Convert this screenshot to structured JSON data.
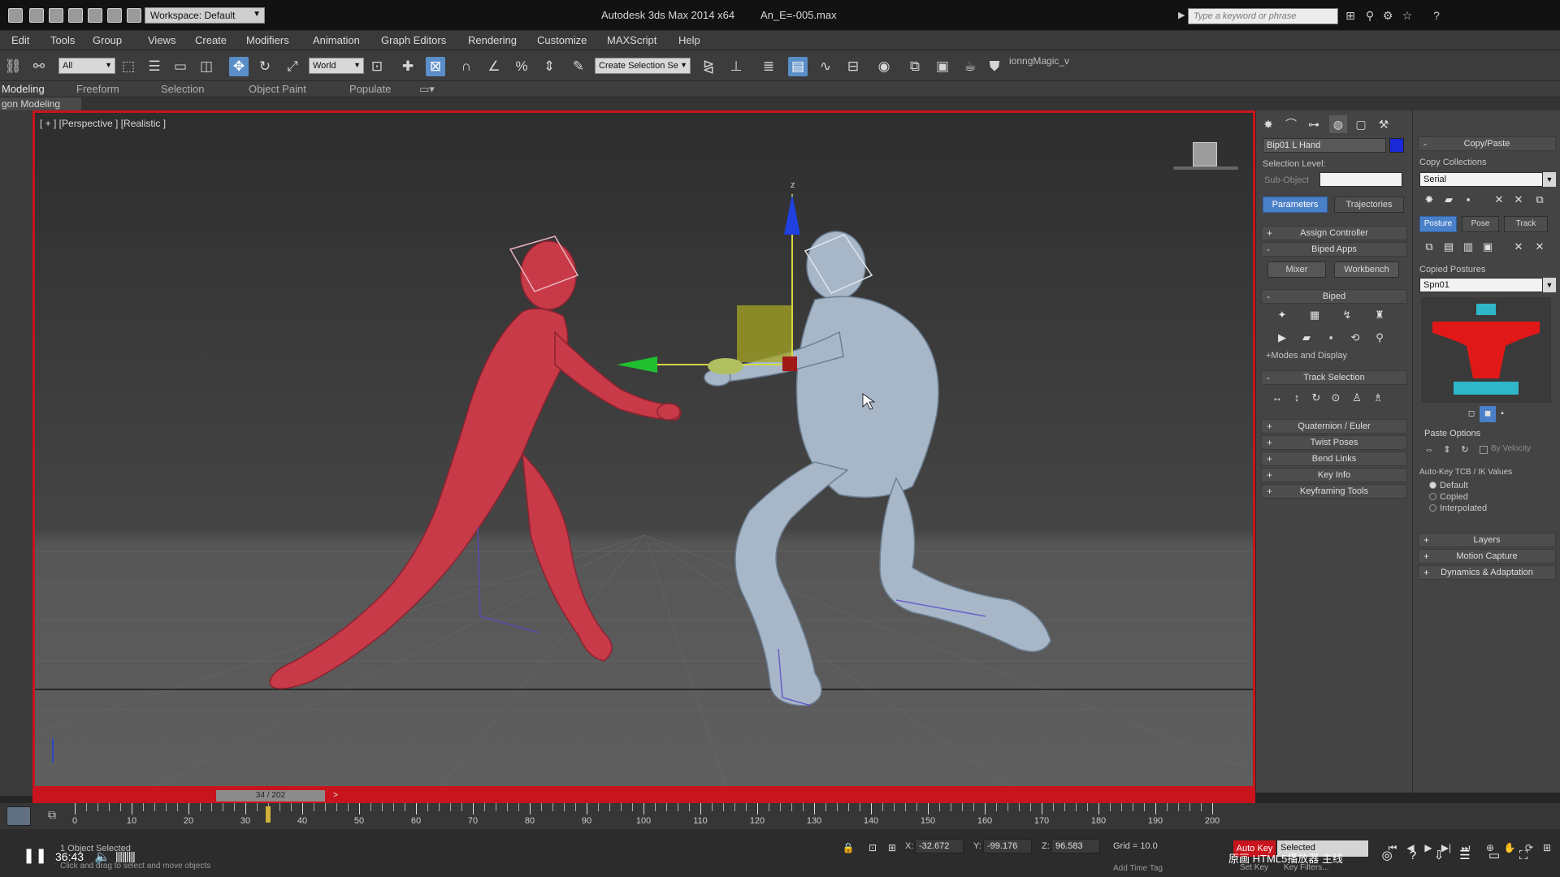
{
  "titlebar": {
    "workspace": "Workspace: Default",
    "app_title": "Autodesk 3ds Max  2014 x64",
    "file_title": "An_E=-005.max",
    "search_placeholder": "Type a keyword or phrase"
  },
  "menu": [
    "Edit",
    "Tools",
    "Group",
    "Views",
    "Create",
    "Modifiers",
    "Animation",
    "Graph Editors",
    "Rendering",
    "Customize",
    "MAXScript",
    "Help"
  ],
  "toolbar": {
    "filter_value": "All",
    "coord_system": "World",
    "named_selection_placeholder": "Create Selection Se",
    "macro_label": "ionngMagic_v"
  },
  "ribbon": {
    "tabs": [
      "Modeling",
      "Freeform",
      "Selection",
      "Object Paint",
      "Populate"
    ],
    "sub_label": "gon Modeling"
  },
  "viewport": {
    "label": "[ + ] [Perspective ] [Realistic ]"
  },
  "command_panel": {
    "object_name": "Bip01 L Hand",
    "object_color": "#1a28d8",
    "selection_level_label": "Selection Level:",
    "sub_object_label": "Sub-Object",
    "tabs": [
      "Parameters",
      "Trajectories"
    ],
    "rollouts_top": [
      "Assign Controller",
      "Biped Apps"
    ],
    "biped_apps_buttons": [
      "Mixer",
      "Workbench"
    ],
    "biped_label": "Biped",
    "modes_display": "+Modes and Display",
    "track_selection": "Track Selection",
    "rollouts_bottom": [
      "Quaternion / Euler",
      "Twist Poses",
      "Bend Links",
      "Key Info",
      "Keyframing Tools"
    ]
  },
  "motion_panel": {
    "copy_paste": "Copy/Paste",
    "copy_collections_label": "Copy Collections",
    "collection_value": "Serial",
    "mode_tabs": [
      "Posture",
      "Pose",
      "Track"
    ],
    "copied_postures_label": "Copied Postures",
    "posture_value": "Spn01",
    "paste_options": "Paste Options",
    "by_velocity": "By Velocity",
    "autokey_label": "Auto-Key TCB / IK Values",
    "radio_options": [
      "Default",
      "Copied",
      "Interpolated"
    ],
    "rollouts": [
      "Layers",
      "Motion Capture",
      "Dynamics & Adaptation"
    ]
  },
  "timeline": {
    "frame_display": "34 / 202",
    "current_frame": 34,
    "ticks": [
      "0",
      "10",
      "20",
      "30",
      "40",
      "50",
      "60",
      "70",
      "80",
      "90",
      "100",
      "110",
      "120",
      "130",
      "140",
      "150",
      "160",
      "170",
      "180",
      "190",
      "200"
    ]
  },
  "status": {
    "selection": "1 Object Selected",
    "hint": "Click and drag to select and move objects",
    "x_label": "X:",
    "x_value": "-32.672",
    "y_label": "Y:",
    "y_value": "-99.176",
    "z_label": "Z:",
    "z_value": "96.583",
    "grid": "Grid = 10.0",
    "add_time_tag": "Add Time Tag",
    "auto_key": "Auto Key",
    "selected_value": "Selected",
    "set_key": "Set Key",
    "key_filters": "Key Filters..."
  },
  "video": {
    "time": "36:43",
    "overlay": "原画  HTML5播放器  主线"
  },
  "colors": {
    "viewport_border": "#c8141c",
    "character_left": "#c83a48",
    "character_right": "#a7b7c8",
    "accent": "#4a80c8"
  }
}
